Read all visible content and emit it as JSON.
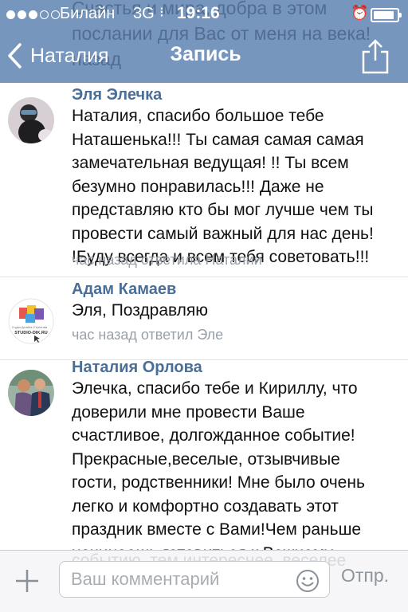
{
  "status_bar": {
    "carrier": "Билайн",
    "network": "3G",
    "time": "19:16",
    "signal_bars_filled": 3,
    "signal_bars_total": 5,
    "battery_level": 0.9
  },
  "header_ghost_text": "Счастья и мира, добра в этом\nпослании для Вас от меня на века!\n             назад",
  "navbar": {
    "back_label": "Наталия",
    "title": "Запись",
    "share_icon": "share-icon"
  },
  "comments": [
    {
      "author": "Эля Элечка",
      "text": "Наталия, спасибо большое тебе\nНаташенька!!! Ты самая  самая самая\nзамечательная ведущая! !! Ты всем\nбезумно понравилась!!! Даже не\nпредставляю кто бы мог лучше чем ты\nпровести самый важный для нас день!\n!Буду всегда и всем тебя советовать!!!",
      "meta": "час назад ответила Наталии"
    },
    {
      "author": "Адам Камаев",
      "text": "Эля, Поздравляю",
      "meta": "час назад ответил Эле",
      "avatar_logo_text": "STUDIO-DIK.RU"
    },
    {
      "author": "Наталия Орлова",
      "text": "Элечка, спасибо тебе и Кириллу, что\nдоверили мне провести Ваше\nсчастливое, долгожданное событие!\nПрекрасные,веселые, отзывчивые\nгости, родственники! Мне было очень\nлегко и комфортно создавать этот\nпраздник вместе с Вами!Чем раньше\nначинаешь готовиться к Важному"
    }
  ],
  "input_ghost_text": "событию, тем интереснее, веселее\nбудет",
  "input_bar": {
    "placeholder": "Ваш комментарий",
    "send_label": "Отпр."
  },
  "colors": {
    "header": "#6c8eb9",
    "author": "#4a6e96",
    "meta": "#9aa0a8"
  }
}
